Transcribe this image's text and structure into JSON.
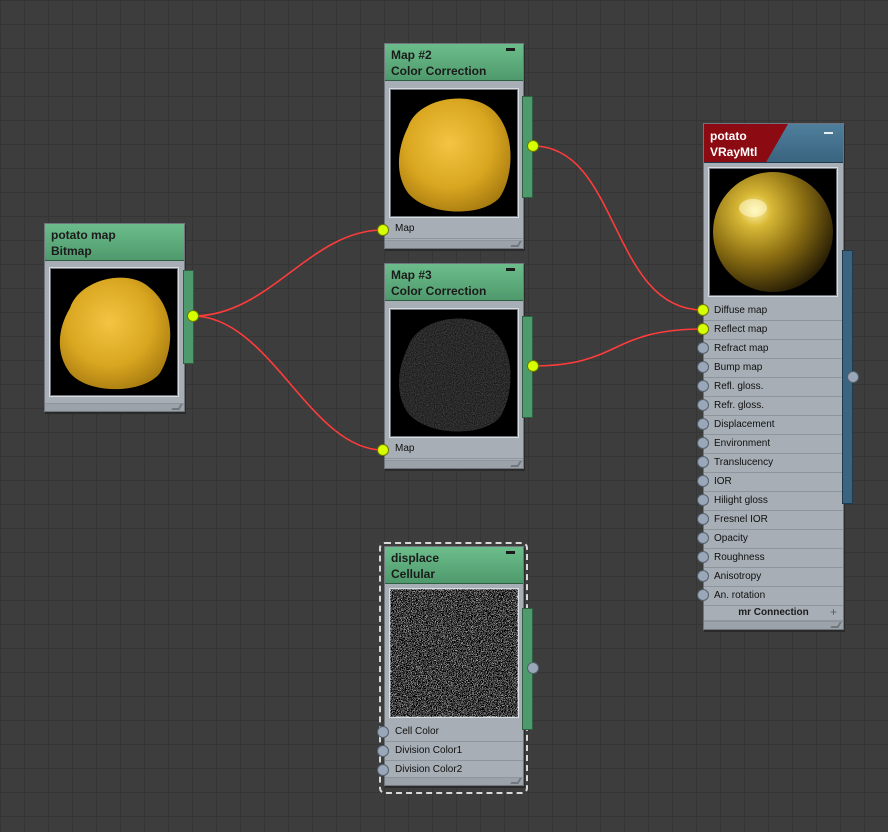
{
  "nodes": {
    "bitmap": {
      "title": "potato map",
      "type": "Bitmap"
    },
    "cc2": {
      "title": "Map #2",
      "type": "Color Correction",
      "input_label": "Map"
    },
    "cc3": {
      "title": "Map #3",
      "type": "Color Correction",
      "input_label": "Map"
    },
    "cellular": {
      "title": "displace",
      "type": "Cellular",
      "inputs": [
        "Cell Color",
        "Division Color1",
        "Division Color2"
      ]
    },
    "vray": {
      "title": "potato",
      "type": "VRayMtl",
      "inputs": [
        "Diffuse map",
        "Reflect map",
        "Refract map",
        "Bump map",
        "Refl. gloss.",
        "Refr. gloss.",
        "Displacement",
        "Environment",
        "Translucency",
        "IOR",
        "Hilight gloss",
        "Fresnel IOR",
        "Opacity",
        "Roughness",
        "Anisotropy",
        "An. rotation"
      ],
      "footer": "mr Connection"
    }
  },
  "colors": {
    "canvas": "#3d3d3d",
    "node_header": "#5fae7f",
    "wire": "#ff3b3b",
    "socket_connected": "#d6ff00",
    "socket_empty": "#9aa7b8",
    "vray_red": "#8c0a12",
    "vray_blue": "#3a6480"
  }
}
